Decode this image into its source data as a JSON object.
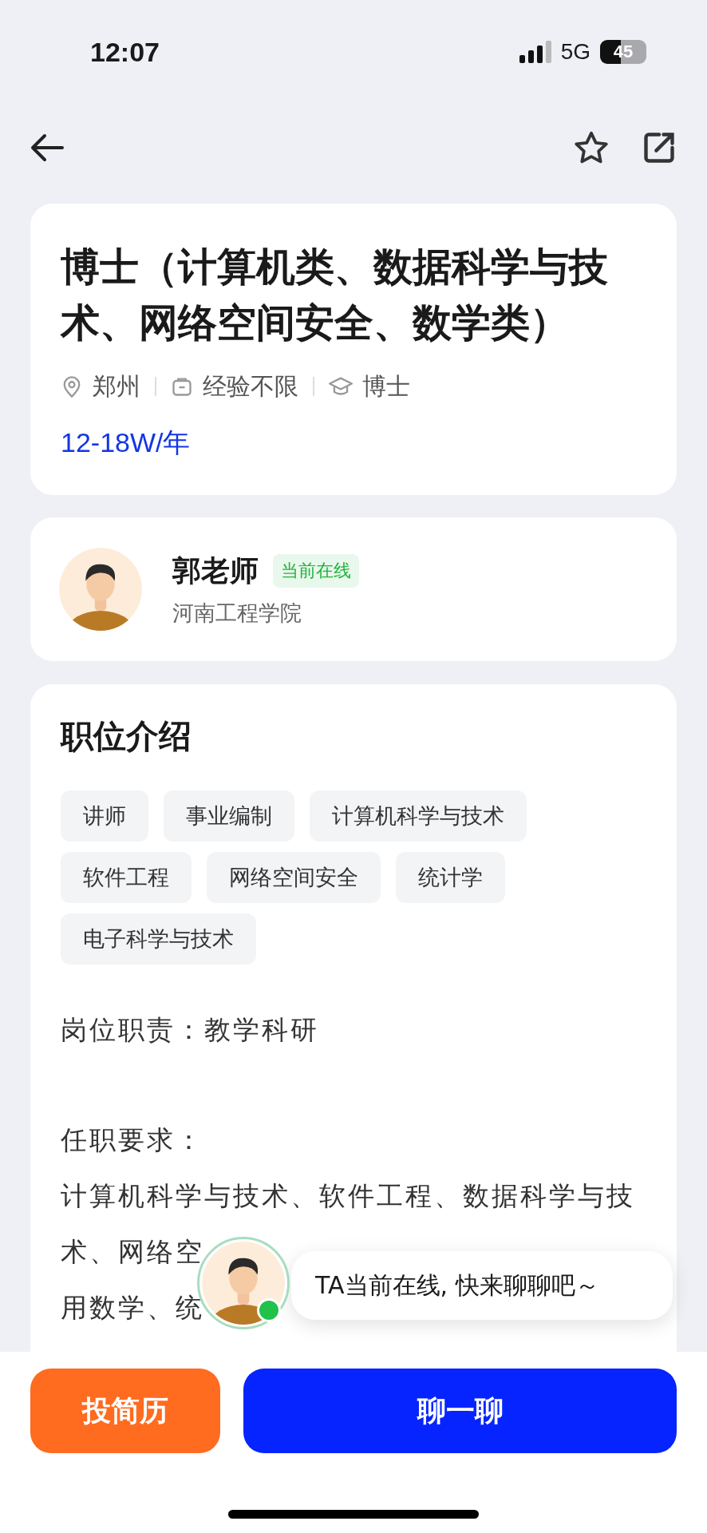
{
  "status_bar": {
    "time": "12:07",
    "network": "5G",
    "battery": "45"
  },
  "job": {
    "title": "博士（计算机类、数据科学与技术、网络空间安全、数学类）",
    "meta": [
      {
        "kind": "location",
        "text": "郑州"
      },
      {
        "kind": "experience",
        "text": "经验不限"
      },
      {
        "kind": "education",
        "text": "博士"
      }
    ],
    "salary": "12-18W/年"
  },
  "recruiter": {
    "name": "郭老师",
    "status": "当前在线",
    "org": "河南工程学院"
  },
  "description": {
    "heading": "职位介绍",
    "tags": [
      "讲师",
      "事业编制",
      "计算机科学与技术",
      "软件工程",
      "网络空间安全",
      "统计学",
      "电子科学与技术"
    ],
    "duty": "岗位职责：教学科研",
    "requirements_label": "任职要求：",
    "requirement_lines": [
      "计算机科学与技术、软件工程、数据科学与技",
      "术、网络空",
      "用数学、统"
    ]
  },
  "chat_prompt": {
    "online": true,
    "message": "TA当前在线, 快来聊聊吧～"
  },
  "actions": [
    {
      "kind": "secondary",
      "label": "投简历"
    },
    {
      "kind": "primary",
      "label": "聊一聊"
    }
  ]
}
